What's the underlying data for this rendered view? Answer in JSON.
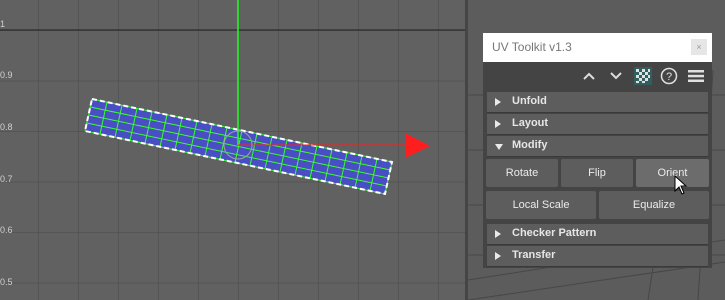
{
  "viewport": {
    "axis_labels": [
      "1",
      "0.9",
      "0.8",
      "0.7",
      "0.6",
      "0.5"
    ]
  },
  "panel": {
    "title": "UV Toolkit v1.3",
    "close_label": "×",
    "toolbar_icons": [
      "chevron-up-icon",
      "chevron-down-icon",
      "checker-icon",
      "help-icon",
      "menu-icon"
    ],
    "help_glyph": "?",
    "sections": [
      {
        "label": "Unfold",
        "expanded": false
      },
      {
        "label": "Layout",
        "expanded": false
      },
      {
        "label": "Modify",
        "expanded": true
      },
      {
        "label": "Checker Pattern",
        "expanded": false
      },
      {
        "label": "Transfer",
        "expanded": false
      }
    ],
    "modify_buttons": {
      "rotate": "Rotate",
      "flip": "Flip",
      "orient": "Orient",
      "local_scale": "Local Scale",
      "equalize": "Equalize"
    }
  },
  "colors": {
    "uv_fill": "#4a4ec4",
    "uv_edge": "#39ff2c",
    "axis_x": "#ff1e1e",
    "axis_y": "#22ff22"
  }
}
